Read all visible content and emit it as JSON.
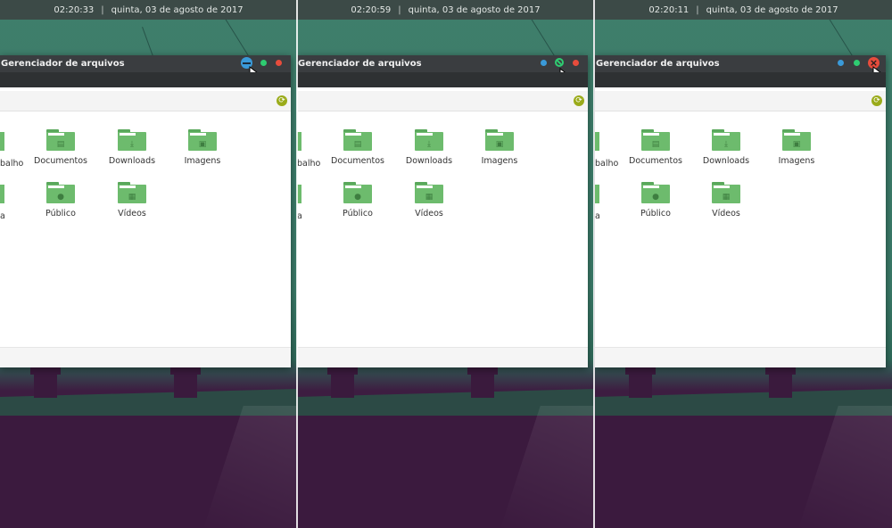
{
  "panels": [
    {
      "clock": "02:20:33",
      "date": "quinta, 03 de agosto de 2017",
      "window_title": "Gerenciador de arquivos",
      "hover": "minimize",
      "partial_labels": [
        "balho",
        "a"
      ]
    },
    {
      "clock": "02:20:59",
      "date": "quinta, 03 de agosto de 2017",
      "window_title": "Gerenciador de arquivos",
      "hover": "maximize",
      "partial_labels": [
        "balho",
        "a"
      ]
    },
    {
      "clock": "02:20:11",
      "date": "quinta, 03 de agosto de 2017",
      "window_title": "Gerenciador de arquivos",
      "hover": "close",
      "partial_labels": [
        "balho",
        "a"
      ]
    }
  ],
  "folders": [
    {
      "label": "Documentos",
      "icon": "document-icon"
    },
    {
      "label": "Downloads",
      "icon": "download-icon"
    },
    {
      "label": "Imagens",
      "icon": "image-icon"
    },
    {
      "label": "Público",
      "icon": "people-icon"
    },
    {
      "label": "Vídeos",
      "icon": "film-icon"
    }
  ],
  "separator": "|",
  "colors": {
    "minimize": "#3a9ad9",
    "maximize": "#2ecc71",
    "close": "#e74c3c",
    "folder": "#6dbb6d",
    "refresh": "#9aab1a"
  }
}
